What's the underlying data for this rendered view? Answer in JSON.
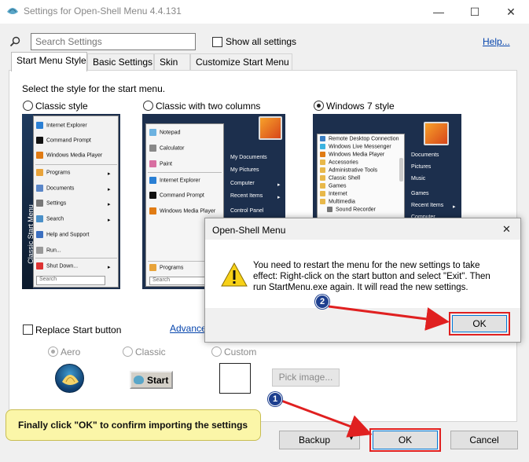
{
  "window": {
    "title": "Settings for Open-Shell Menu 4.4.131",
    "minimize": "—",
    "maximize": "☐",
    "close": "✕"
  },
  "search": {
    "placeholder": "Search Settings",
    "show_all": "Show all settings",
    "help": "Help..."
  },
  "tabs": [
    {
      "label": "Start Menu Style",
      "active": true
    },
    {
      "label": "Basic Settings"
    },
    {
      "label": "Skin"
    },
    {
      "label": "Customize Start Menu"
    }
  ],
  "style_prompt": "Select the style for the start menu.",
  "styles": [
    {
      "label": "Classic style",
      "selected": false
    },
    {
      "label": "Classic with two columns",
      "selected": false
    },
    {
      "label": "Windows 7 style",
      "selected": true
    }
  ],
  "preview_classic": {
    "side_label": "Classic Start Menu",
    "items": [
      "Internet Explorer",
      "Command Prompt",
      "Windows Media Player",
      "Programs",
      "Documents",
      "Settings",
      "Search",
      "Help and Support",
      "Run...",
      "Shut Down..."
    ],
    "search": "Search"
  },
  "preview_two_col": {
    "left_items": [
      "Notepad",
      "Calculator",
      "Paint",
      "Internet Explorer",
      "Command Prompt",
      "Windows Media Player"
    ],
    "right_items": [
      "My Documents",
      "My Pictures",
      "Computer",
      "Recent Items",
      "Control Panel"
    ],
    "programs": "Programs",
    "search": "Search"
  },
  "preview_win7": {
    "left_items": [
      "Remote Desktop Connection",
      "Windows Live Messenger",
      "Windows Media Player",
      "Accessories",
      "Administrative Tools",
      "Classic Shell",
      "Games",
      "Internet",
      "Multimedia",
      "Sound Recorder"
    ],
    "right_items": [
      "Documents",
      "Pictures",
      "Music",
      "Games",
      "Recent Items",
      "Computer"
    ]
  },
  "replace_start": {
    "label": "Replace Start button",
    "checked": false,
    "advanced": "Advance"
  },
  "button_styles": [
    {
      "label": "Aero",
      "selected": true
    },
    {
      "label": "Classic",
      "selected": false
    },
    {
      "label": "Custom",
      "selected": false
    }
  ],
  "classic_start_label": "Start",
  "pick_image": "Pick image...",
  "dialog": {
    "title": "Open-Shell Menu",
    "message_line1": "You need to restart the menu for the new settings to take",
    "message_line2": "effect: Right-click on the start button and select \"Exit\". Then",
    "message_line3": "run StartMenu.exe again. It will read the new settings.",
    "ok": "OK",
    "close": "✕"
  },
  "footer": {
    "backup": "Backup",
    "ok": "OK",
    "cancel": "Cancel"
  },
  "annotations": {
    "badge1": "1",
    "badge2": "2",
    "tip": "Finally click \"OK\" to confirm importing the settings"
  },
  "colors": {
    "accent_red": "#e02020",
    "badge_blue": "#1d3f8f",
    "tip_yellow": "#fbf6a8",
    "preview_dark": "#1c2f4d"
  }
}
